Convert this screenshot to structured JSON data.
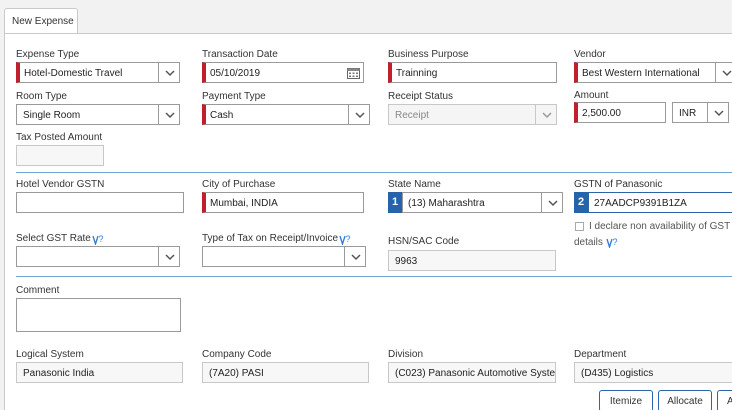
{
  "tab": {
    "label": "New Expense"
  },
  "fields": {
    "expense_type": {
      "label": "Expense Type",
      "value": "Hotel-Domestic Travel"
    },
    "transaction_date": {
      "label": "Transaction Date",
      "value": "05/10/2019"
    },
    "business_purpose": {
      "label": "Business Purpose",
      "value": "Trainning"
    },
    "vendor": {
      "label": "Vendor",
      "value": "Best Western International"
    },
    "room_type": {
      "label": "Room Type",
      "value": "Single Room"
    },
    "payment_type": {
      "label": "Payment Type",
      "value": "Cash"
    },
    "receipt_status": {
      "label": "Receipt Status",
      "value": "Receipt"
    },
    "amount": {
      "label": "Amount",
      "value": "2,500.00",
      "currency": "INR"
    },
    "tax_posted_amount": {
      "label": "Tax Posted Amount",
      "value": ""
    },
    "hotel_vendor_gstn": {
      "label": "Hotel Vendor GSTN",
      "value": ""
    },
    "city_of_purchase": {
      "label": "City of Purchase",
      "value": "Mumbai, INDIA"
    },
    "state_name": {
      "label": "State Name",
      "value": "(13) Maharashtra",
      "badge": "1"
    },
    "gstn_of_panasonic": {
      "label": "GSTN of Panasonic",
      "value": "27AADCP9391B1ZA",
      "badge": "2"
    },
    "declare_gst": {
      "label_line1": "I declare non availability of GST",
      "label_line2": "details"
    },
    "select_gst_rate": {
      "label": "Select GST Rate",
      "value": ""
    },
    "type_of_tax": {
      "label": "Type of Tax on Receipt/Invoice",
      "value": ""
    },
    "hsn_sac_code": {
      "label": "HSN/SAC Code",
      "value": "9963"
    },
    "comment": {
      "label": "Comment",
      "value": ""
    },
    "logical_system": {
      "label": "Logical System",
      "value": "Panasonic India"
    },
    "company_code": {
      "label": "Company Code",
      "value": "(7A20) PASI"
    },
    "division": {
      "label": "Division",
      "value": "(C023) Panasonic Automotive Syste"
    },
    "department": {
      "label": "Department",
      "value": "(D435) Logistics"
    }
  },
  "buttons": {
    "itemize": "Itemize",
    "allocate": "Allocate",
    "partial": "A"
  },
  "colors": {
    "required": "#c0202e",
    "accent": "#2763a8",
    "separator": "#6fa3d6"
  },
  "icons": [
    "chevron-down-icon",
    "calendar-icon",
    "help-icon",
    "checkbox-icon"
  ]
}
